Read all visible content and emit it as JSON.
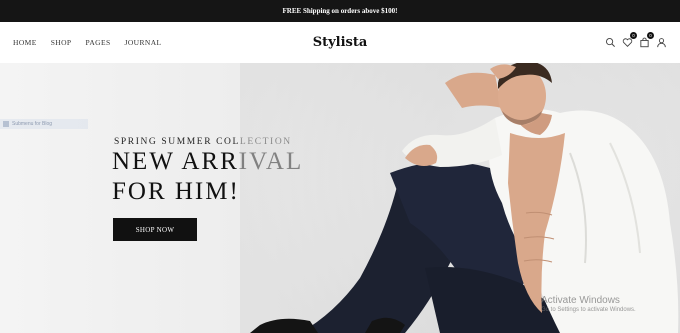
{
  "topbar": {
    "text": "FREE Shipping on orders above $100!"
  },
  "header": {
    "nav": [
      "HOME",
      "SHOP",
      "PAGES",
      "JOURNAL"
    ],
    "logo": "Stylista",
    "icons": {
      "search": "search-icon",
      "wishlist": "heart-icon",
      "wishlist_count": "0",
      "cart": "bag-icon",
      "cart_count": "0",
      "account": "user-icon"
    }
  },
  "hero": {
    "side_tab": "Submenu for Blog",
    "subtitle": "SPRING SUMMER COLLECTION",
    "title_line1": "NEW ARRIVAL",
    "title_line2": "FOR HIM!",
    "button": "SHOP NOW",
    "colors": {
      "button_bg": "#111111",
      "topbar_bg": "#151515",
      "shirt": "#f7f7f5",
      "jeans": "#1c2130"
    }
  },
  "watermark": {
    "line1": "Activate Windows",
    "line2": "Go to Settings to activate Windows."
  }
}
